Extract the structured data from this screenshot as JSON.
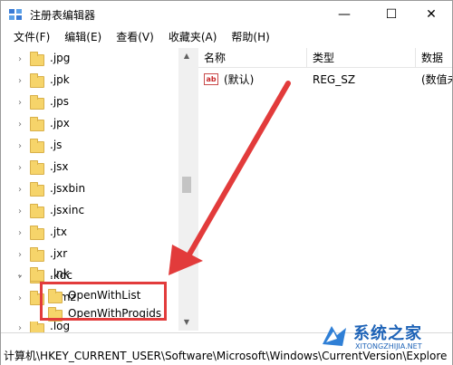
{
  "window": {
    "title": "注册表编辑器",
    "controls": {
      "minimize": "—",
      "maximize": "☐",
      "close": "✕"
    }
  },
  "menu": [
    "文件(F)",
    "编辑(E)",
    "查看(V)",
    "收藏夹(A)",
    "帮助(H)"
  ],
  "tree": {
    "items": [
      {
        "label": ".jpg",
        "expanded": false
      },
      {
        "label": ".jpk",
        "expanded": false
      },
      {
        "label": ".jps",
        "expanded": false
      },
      {
        "label": ".jpx",
        "expanded": false
      },
      {
        "label": ".js",
        "expanded": false
      },
      {
        "label": ".jsx",
        "expanded": false
      },
      {
        "label": ".jsxbin",
        "expanded": false
      },
      {
        "label": ".jsxinc",
        "expanded": false
      },
      {
        "label": ".jtx",
        "expanded": false
      },
      {
        "label": ".jxr",
        "expanded": false
      },
      {
        "label": ".kdc",
        "expanded": false
      },
      {
        "label": ".kmz",
        "expanded": false
      },
      {
        "label": ".lnk",
        "expanded": true
      },
      {
        "label": "OpenWithList",
        "child": true
      },
      {
        "label": "OpenWithProgids",
        "child": true
      },
      {
        "label": ".log",
        "expanded": false
      }
    ]
  },
  "list": {
    "headers": {
      "name": "名称",
      "type": "类型",
      "data": "数据"
    },
    "rows": [
      {
        "name": "(默认)",
        "type": "REG_SZ",
        "data": "(数值未"
      }
    ]
  },
  "status": {
    "path": "计算机\\HKEY_CURRENT_USER\\Software\\Microsoft\\Windows\\CurrentVersion\\Explore"
  },
  "watermark": {
    "brand": "系统之家",
    "site": "XITONGZHIJIA.NET"
  },
  "colors": {
    "annotation": "#e23b3b",
    "folder": "#f6d46a",
    "watermark": "#1e63b7"
  }
}
